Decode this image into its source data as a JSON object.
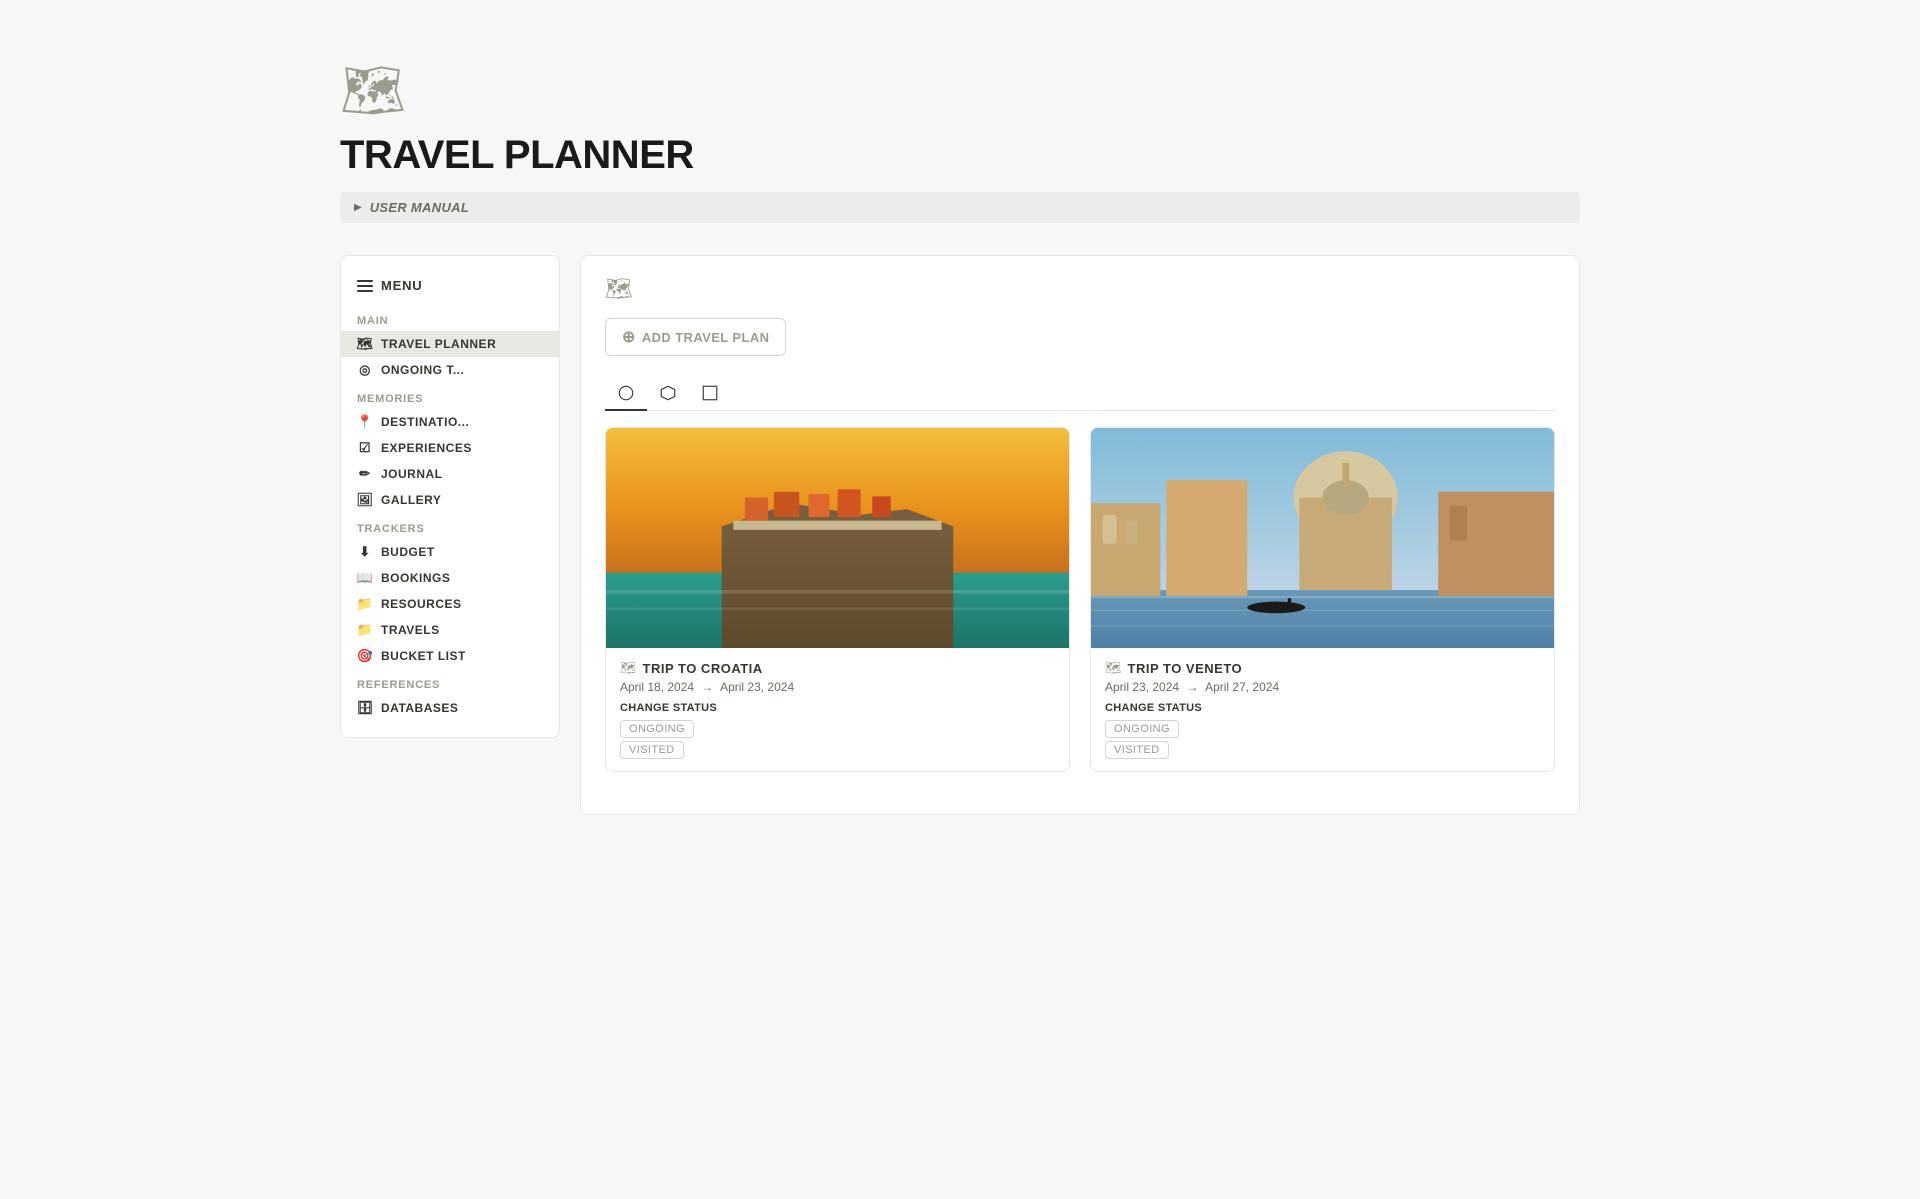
{
  "page": {
    "icon": "🗺",
    "title": "TRAVEL PLANNER",
    "user_manual_label": "USER MANUAL"
  },
  "sidebar": {
    "menu_label": "MENU",
    "sections": [
      {
        "title": "MAIN",
        "items": [
          {
            "id": "travel-planner",
            "icon": "🗺",
            "label": "TRAVEL PLANNER",
            "active": true
          },
          {
            "id": "ongoing-t",
            "icon": "◎",
            "label": "ONGOING T..."
          }
        ]
      },
      {
        "title": "MEMORIES",
        "items": [
          {
            "id": "destinations",
            "icon": "📍",
            "label": "DESTINATIO..."
          },
          {
            "id": "experiences",
            "icon": "☑",
            "label": "EXPERIENCES"
          },
          {
            "id": "journal",
            "icon": "✏",
            "label": "JOURNAL"
          },
          {
            "id": "gallery",
            "icon": "🖼",
            "label": "GALLERY"
          }
        ]
      },
      {
        "title": "TRACKERS",
        "items": [
          {
            "id": "budget",
            "icon": "⬇",
            "label": "BUDGET"
          },
          {
            "id": "bookings",
            "icon": "📖",
            "label": "BOOKINGS"
          },
          {
            "id": "resources",
            "icon": "📁",
            "label": "RESOURCES"
          },
          {
            "id": "travels",
            "icon": "📁",
            "label": "TRAVELS"
          },
          {
            "id": "bucket-list",
            "icon": "🎯",
            "label": "BUCKET LIST"
          }
        ]
      },
      {
        "title": "REFERENCES",
        "items": [
          {
            "id": "databases",
            "icon": "🗄",
            "label": "DATABASES"
          }
        ]
      }
    ]
  },
  "main_panel": {
    "add_button_label": "ADD TRAVEL PLAN",
    "view_tabs": [
      {
        "id": "circle",
        "active": true
      },
      {
        "id": "hexagon"
      },
      {
        "id": "square"
      }
    ],
    "cards": [
      {
        "id": "croatia",
        "title": "TRIP TO CROATIA",
        "date_start": "April 18, 2024",
        "date_end": "April 23, 2024",
        "change_status_label": "CHANGE STATUS",
        "statuses": [
          "ONGOING",
          "VISITED"
        ],
        "image_type": "croatia"
      },
      {
        "id": "veneto",
        "title": "TRIP TO VENETO",
        "date_start": "April 23, 2024",
        "date_end": "April 27, 2024",
        "change_status_label": "CHANGE STATUS",
        "statuses": [
          "ONGOING",
          "VISITED"
        ],
        "image_type": "venice"
      }
    ]
  },
  "colors": {
    "accent": "#37352f",
    "muted": "#9b9b8e",
    "border": "#e8e8e3",
    "bg": "#f7f7f5"
  }
}
